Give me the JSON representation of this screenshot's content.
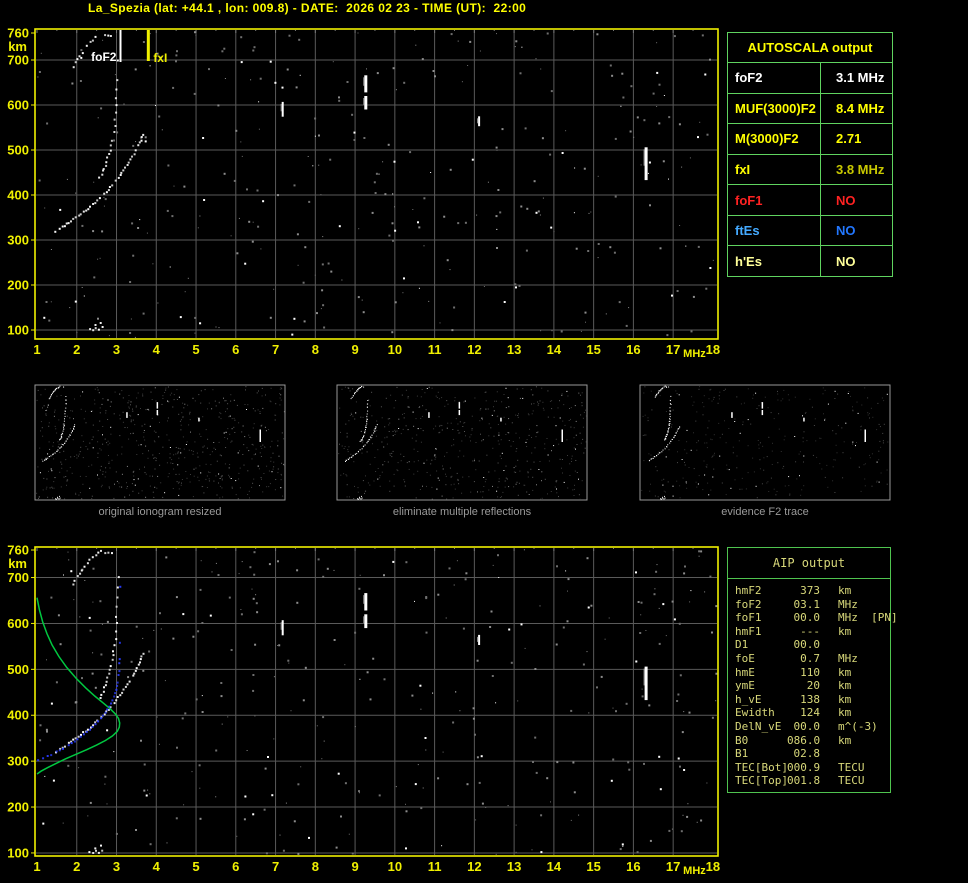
{
  "window": {
    "title": "La_Spezia (lat: +44.1 , lon: 009.8) - DATE:  2026 02 23 - TIME (UT):  22:00"
  },
  "colors": {
    "background": "#000000",
    "axis_yellow": "#f0f000",
    "title_yellow": "#ffff00",
    "grid_gray": "#5a5a5a",
    "echo_white": "#ffffff",
    "profile_green": "#00c840",
    "fit_blue": "#2a3cff",
    "autoscala_border_green": "#5fd35f",
    "aip_border_green": "#4fc44f",
    "aip_text": "#d8d87a",
    "caption_gray": "#9a9a9a",
    "thumb_border": "#999999"
  },
  "autoscala_table": {
    "header": "AUTOSCALA output",
    "rows": [
      {
        "label": "foF2",
        "value": "3.1 MHz",
        "label_color": "#ffffff",
        "value_color": "#ffffff"
      },
      {
        "label": "MUF(3000)F2",
        "value": "8.4 MHz",
        "label_color": "#ffff00",
        "value_color": "#ffff00"
      },
      {
        "label": "M(3000)F2",
        "value": "2.71",
        "label_color": "#ffff00",
        "value_color": "#ffff00"
      },
      {
        "label": "fxI",
        "value": "3.8 MHz",
        "label_color": "#ffff00",
        "value_color": "#c8c800"
      },
      {
        "label": "foF1",
        "value": "NO",
        "label_color": "#ff2222",
        "value_color": "#ff2222"
      },
      {
        "label": "ftEs",
        "value": "NO",
        "label_color": "#44aaff",
        "value_color": "#2277ff"
      },
      {
        "label": "h'Es",
        "value": "NO",
        "label_color": "#ffff99",
        "value_color": "#ffff99"
      }
    ]
  },
  "aip_table": {
    "header": "AIP output",
    "rows": [
      {
        "label": "hmF2",
        "value": "373",
        "unit": "km"
      },
      {
        "label": "foF2",
        "value": "03.1",
        "unit": "MHz"
      },
      {
        "label": "foF1",
        "value": "00.0",
        "unit": "MHz  [PN]"
      },
      {
        "label": "hmF1",
        "value": "---",
        "unit": "km"
      },
      {
        "label": "D1",
        "value": "00.0",
        "unit": ""
      },
      {
        "label": "foE",
        "value": "0.7",
        "unit": "MHz"
      },
      {
        "label": "hmE",
        "value": "110",
        "unit": "km"
      },
      {
        "label": "ymE",
        "value": "20",
        "unit": "km"
      },
      {
        "label": "h_vE",
        "value": "138",
        "unit": "km"
      },
      {
        "label": "Ewidth",
        "value": "124",
        "unit": "km"
      },
      {
        "label": "DelN_vE",
        "value": "00.0",
        "unit": "m^(-3)"
      },
      {
        "label": "B0",
        "value": "086.0",
        "unit": "km"
      },
      {
        "label": "B1",
        "value": "02.8",
        "unit": ""
      },
      {
        "label": "TEC[Bot]",
        "value": "000.9",
        "unit": "TECU"
      },
      {
        "label": "TEC[Top]",
        "value": "001.8",
        "unit": "TECU"
      }
    ]
  },
  "thumbnails": [
    {
      "caption": "original ionogram resized"
    },
    {
      "caption": "eliminate multiple reflections"
    },
    {
      "caption": "evidence F2 trace"
    }
  ],
  "ionogram": {
    "x_unit": "MHz",
    "y_unit": "km",
    "x_ticks": [
      "1",
      "2",
      "3",
      "4",
      "5",
      "6",
      "7",
      "8",
      "9",
      "10",
      "11",
      "12",
      "13",
      "14",
      "15",
      "16",
      "17",
      "18"
    ],
    "y_ticks": [
      {
        "label": "760",
        "km": 760
      },
      {
        "label": "700",
        "km": 700
      },
      {
        "label": "600",
        "km": 600
      },
      {
        "label": "500",
        "km": 500
      },
      {
        "label": "400",
        "km": 400
      },
      {
        "label": "300",
        "km": 300
      },
      {
        "label": "200",
        "km": 200
      },
      {
        "label": "100",
        "km": 100
      }
    ],
    "x_range_mhz": [
      1,
      18
    ],
    "y_range_km": [
      100,
      760
    ],
    "annotations": [
      {
        "label": "foF2",
        "freq_mhz": 3.1,
        "color": "#ffffff"
      },
      {
        "label": "fxI",
        "freq_mhz": 3.8,
        "color": "#f0f000"
      }
    ],
    "traces": {
      "f2_main": [
        [
          1.45,
          322
        ],
        [
          1.56,
          328
        ],
        [
          1.67,
          334
        ],
        [
          1.78,
          341
        ],
        [
          1.9,
          348
        ],
        [
          2.02,
          356
        ],
        [
          2.14,
          364
        ],
        [
          2.26,
          372
        ],
        [
          2.38,
          381
        ],
        [
          2.5,
          390
        ],
        [
          2.61,
          399
        ],
        [
          2.72,
          409
        ],
        [
          2.82,
          419
        ],
        [
          2.92,
          430
        ],
        [
          3.02,
          441
        ],
        [
          3.11,
          452
        ],
        [
          3.2,
          463
        ],
        [
          3.29,
          475
        ],
        [
          3.38,
          488
        ],
        [
          3.46,
          500
        ],
        [
          3.53,
          512
        ],
        [
          3.59,
          524
        ],
        [
          3.64,
          536
        ]
      ],
      "f2_cusp": [
        [
          2.56,
          441
        ],
        [
          2.6,
          448
        ],
        [
          2.64,
          455
        ],
        [
          2.67,
          461
        ],
        [
          2.7,
          468
        ],
        [
          2.73,
          476
        ],
        [
          2.76,
          484
        ],
        [
          2.79,
          492
        ],
        [
          2.82,
          501
        ],
        [
          2.85,
          511
        ],
        [
          2.87,
          521
        ],
        [
          2.89,
          532
        ],
        [
          2.91,
          543
        ],
        [
          2.93,
          556
        ],
        [
          2.95,
          570
        ],
        [
          2.96,
          585
        ],
        [
          2.97,
          601
        ],
        [
          2.98,
          618
        ],
        [
          2.99,
          637
        ],
        [
          3.0,
          658
        ],
        [
          3.0,
          680
        ],
        [
          3.01,
          703
        ]
      ],
      "second_hop": [
        [
          1.88,
          688
        ],
        [
          1.93,
          696
        ],
        [
          1.99,
          704
        ],
        [
          2.05,
          712
        ],
        [
          2.11,
          719
        ],
        [
          2.17,
          727
        ],
        [
          2.24,
          734
        ],
        [
          2.31,
          741
        ],
        [
          2.38,
          747
        ],
        [
          2.45,
          752
        ],
        [
          2.52,
          757
        ],
        [
          2.6,
          760
        ],
        [
          2.7,
          757
        ],
        [
          2.84,
          756
        ]
      ],
      "e_region": [
        [
          2.3,
          104
        ],
        [
          2.38,
          102
        ],
        [
          2.46,
          107
        ],
        [
          2.54,
          103
        ],
        [
          2.62,
          108
        ],
        [
          2.44,
          113
        ],
        [
          2.58,
          118
        ]
      ],
      "rfi_streaks": [
        {
          "freq": 7.18,
          "km_low": 574,
          "km_high": 607,
          "w": 2
        },
        {
          "freq": 9.27,
          "km_low": 590,
          "km_high": 620,
          "w": 3
        },
        {
          "freq": 9.27,
          "km_low": 628,
          "km_high": 666,
          "w": 3
        },
        {
          "freq": 12.12,
          "km_low": 553,
          "km_high": 575,
          "w": 2
        },
        {
          "freq": 16.32,
          "km_low": 433,
          "km_high": 506,
          "w": 3
        }
      ],
      "profile_green": [
        [
          1.0,
          656
        ],
        [
          1.06,
          630
        ],
        [
          1.14,
          604
        ],
        [
          1.25,
          578
        ],
        [
          1.38,
          553
        ],
        [
          1.55,
          528
        ],
        [
          1.75,
          504
        ],
        [
          1.98,
          481
        ],
        [
          2.22,
          460
        ],
        [
          2.45,
          442
        ],
        [
          2.66,
          427
        ],
        [
          2.84,
          414
        ],
        [
          2.97,
          403
        ],
        [
          3.05,
          393
        ],
        [
          3.08,
          383
        ],
        [
          3.07,
          374
        ],
        [
          3.02,
          365
        ],
        [
          2.9,
          355
        ],
        [
          2.72,
          345
        ],
        [
          2.5,
          335
        ],
        [
          2.25,
          325
        ],
        [
          1.98,
          315
        ],
        [
          1.72,
          305
        ],
        [
          1.48,
          295
        ],
        [
          1.27,
          286
        ],
        [
          1.1,
          278
        ],
        [
          1.0,
          272
        ]
      ],
      "fit_blue": [
        [
          1.0,
          304
        ],
        [
          1.12,
          308
        ],
        [
          1.25,
          313
        ],
        [
          1.4,
          319
        ],
        [
          1.55,
          326
        ],
        [
          1.7,
          333
        ],
        [
          1.85,
          341
        ],
        [
          2.0,
          350
        ],
        [
          2.15,
          360
        ],
        [
          2.3,
          371
        ],
        [
          2.45,
          383
        ],
        [
          2.58,
          395
        ],
        [
          2.7,
          408
        ],
        [
          2.8,
          421
        ],
        [
          2.88,
          435
        ],
        [
          2.94,
          450
        ],
        [
          2.99,
          466
        ],
        [
          3.02,
          482
        ],
        [
          3.04,
          498
        ],
        [
          3.05,
          515
        ],
        [
          3.06,
          533
        ]
      ],
      "fit_blue_sparse": [
        [
          3.06,
          560
        ],
        [
          3.07,
          682
        ]
      ]
    }
  }
}
